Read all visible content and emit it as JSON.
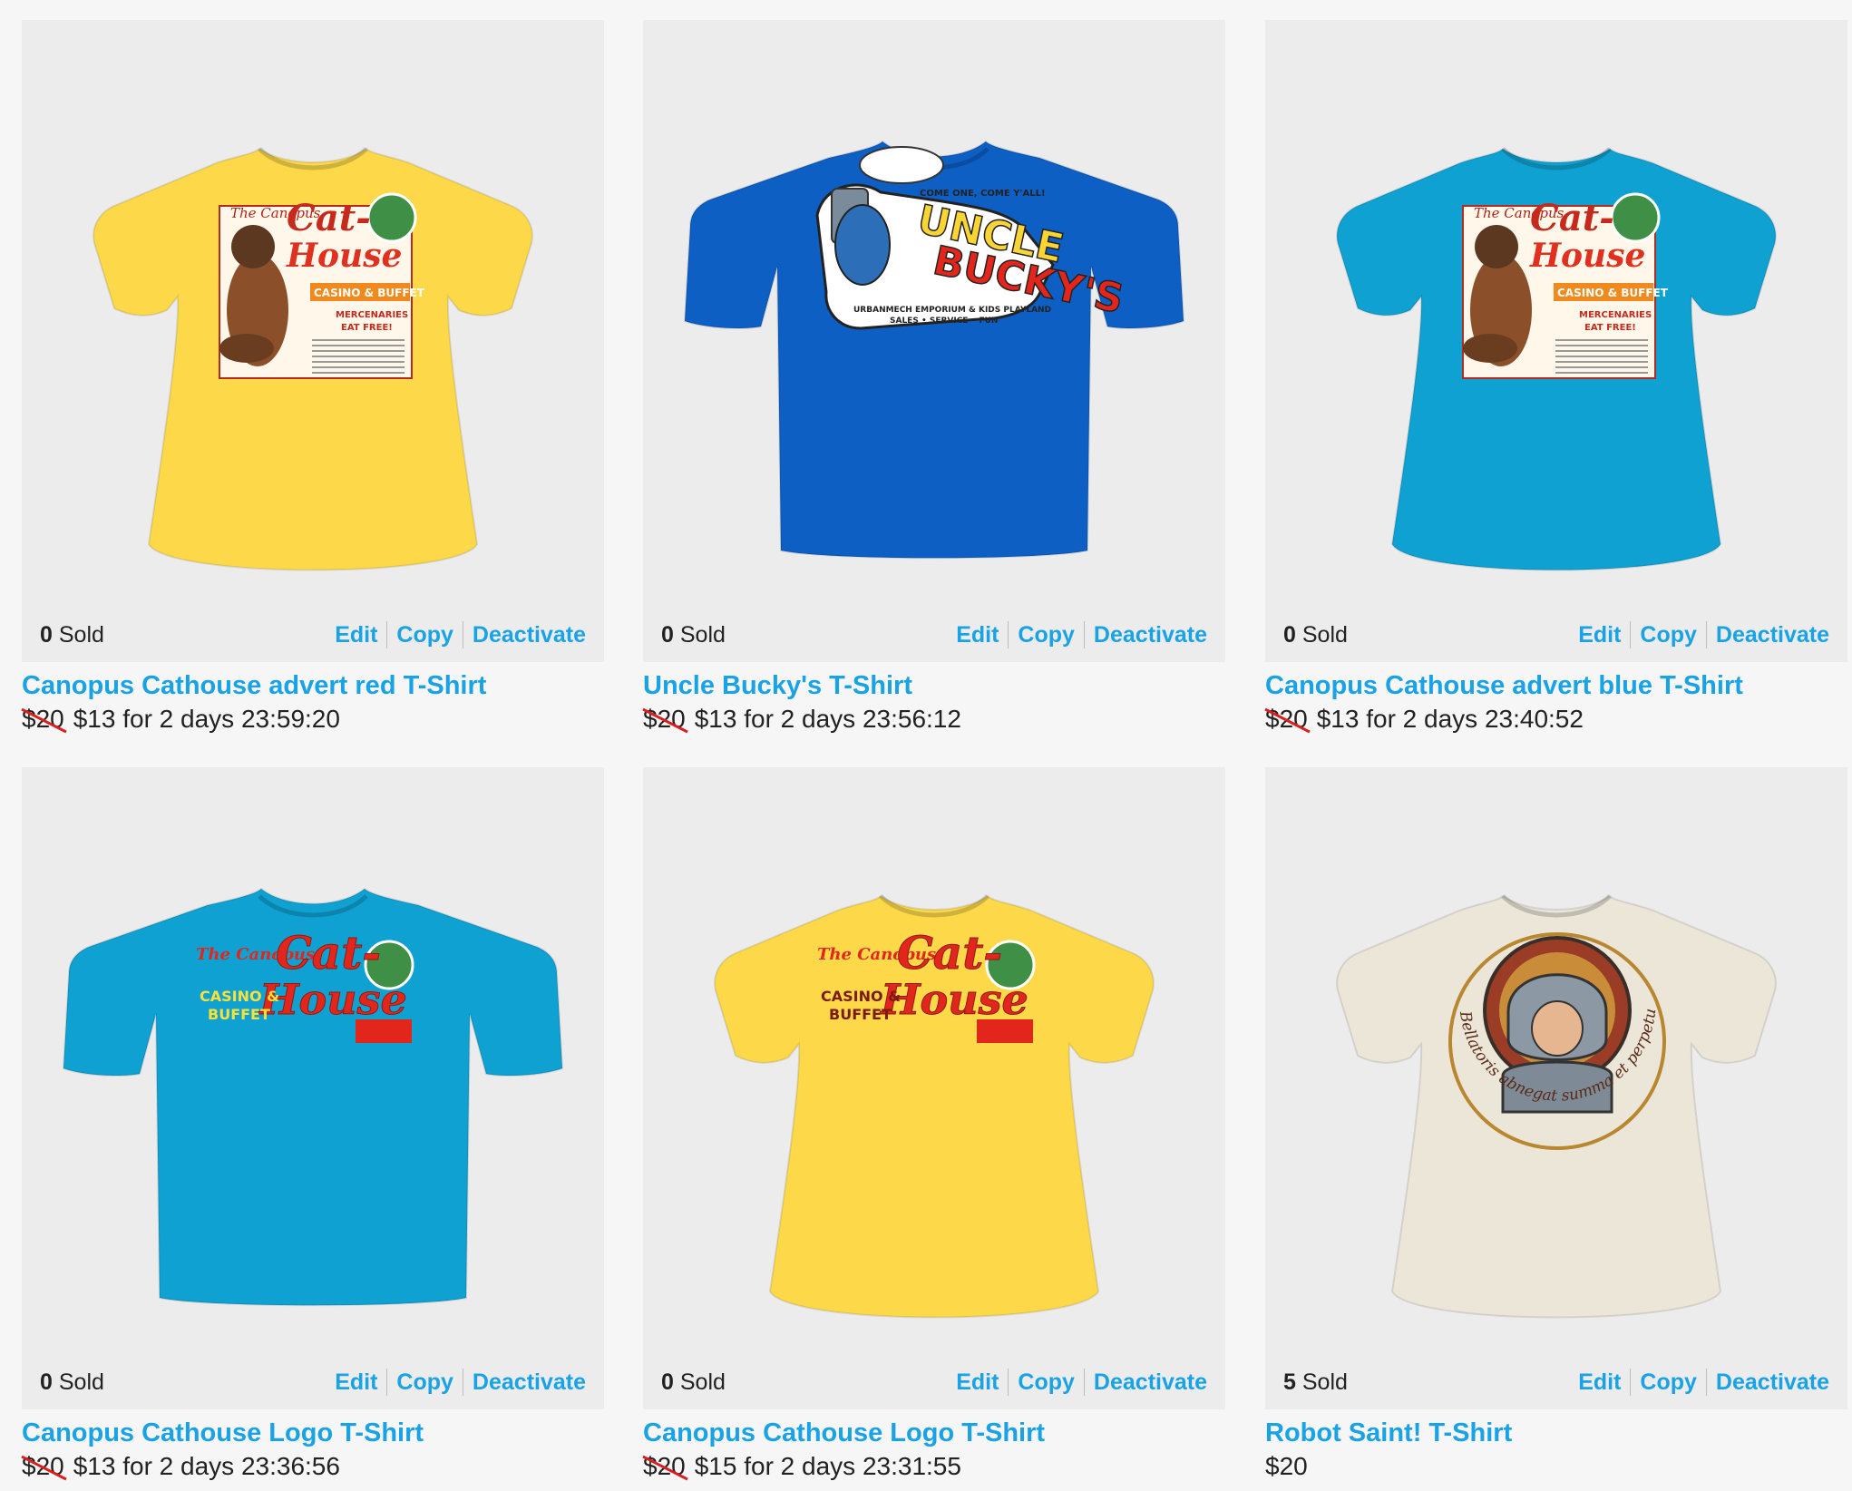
{
  "actions": {
    "edit": "Edit",
    "copy": "Copy",
    "deactivate": "Deactivate"
  },
  "products": [
    {
      "title": "Canopus Cathouse advert red T-Shirt",
      "sold_count": "0",
      "sold_label": "Sold",
      "original_price": "$20",
      "sale_text": "$13 for 2 days 23:59:20",
      "price": "",
      "shirt_color": "#fdd94a",
      "shirt_style": "womens",
      "design": {
        "kind": "cathouse-advert",
        "text_small": "The Canopus",
        "text_big_1": "Cat-",
        "text_big_2": "House",
        "line_1": "CASINO & BUFFET",
        "line_2": "MERCENARIES",
        "line_3": "EAT FREE!"
      }
    },
    {
      "title": "Uncle Bucky's T-Shirt",
      "sold_count": "0",
      "sold_label": "Sold",
      "original_price": "$20",
      "sale_text": "$13 for 2 days 23:56:12",
      "price": "",
      "shirt_color": "#0d5fc4",
      "shirt_style": "mens",
      "design": {
        "kind": "uncle-bucky",
        "text_big_1": "UNCLE",
        "text_big_2": "BUCKY'S",
        "line_1": "COME ONE, COME Y'ALL!",
        "line_2": "URBANMECH EMPORIUM & KIDS PLAYLAND",
        "line_3": "SALES • SERVICE • FUN"
      }
    },
    {
      "title": "Canopus Cathouse advert blue T-Shirt",
      "sold_count": "0",
      "sold_label": "Sold",
      "original_price": "$20",
      "sale_text": "$13 for 2 days 23:40:52",
      "price": "",
      "shirt_color": "#0fa1d2",
      "shirt_style": "womens",
      "design": {
        "kind": "cathouse-advert",
        "text_small": "The Canopus",
        "text_big_1": "Cat-",
        "text_big_2": "House",
        "line_1": "CASINO & BUFFET",
        "line_2": "MERCENARIES",
        "line_3": "EAT FREE!"
      }
    },
    {
      "title": "Canopus Cathouse Logo T-Shirt",
      "sold_count": "0",
      "sold_label": "Sold",
      "original_price": "$20",
      "sale_text": "$13 for 2 days 23:36:56",
      "price": "",
      "shirt_color": "#0fa1d2",
      "shirt_style": "mens",
      "design": {
        "kind": "cathouse-logo",
        "text_small": "The Canopus",
        "text_big_1": "Cat-",
        "text_big_2": "House",
        "line_1": "CASINO &",
        "line_2": "BUFFET",
        "line_3": ""
      }
    },
    {
      "title": "Canopus Cathouse Logo T-Shirt",
      "sold_count": "0",
      "sold_label": "Sold",
      "original_price": "$20",
      "sale_text": "$15 for 2 days 23:31:55",
      "price": "",
      "shirt_color": "#fdd94a",
      "shirt_style": "womens",
      "design": {
        "kind": "cathouse-logo",
        "text_small": "The Canopus",
        "text_big_1": "Cat-",
        "text_big_2": "House",
        "line_1": "CASINO &",
        "line_2": "BUFFET",
        "line_3": ""
      }
    },
    {
      "title": "Robot Saint! T-Shirt",
      "sold_count": "5",
      "sold_label": "Sold",
      "original_price": "",
      "sale_text": "",
      "price": "$20",
      "shirt_color": "#ece6d8",
      "shirt_style": "womens",
      "design": {
        "kind": "robot-saint",
        "line_1": "Bellatoris abnegat summa et perpetua erunt super",
        "line_2": "",
        "line_3": ""
      }
    }
  ],
  "colors": {
    "link": "#19a3e6",
    "strike": "#d81e1e",
    "panel": "#ececec",
    "page": "#f6f6f6"
  }
}
